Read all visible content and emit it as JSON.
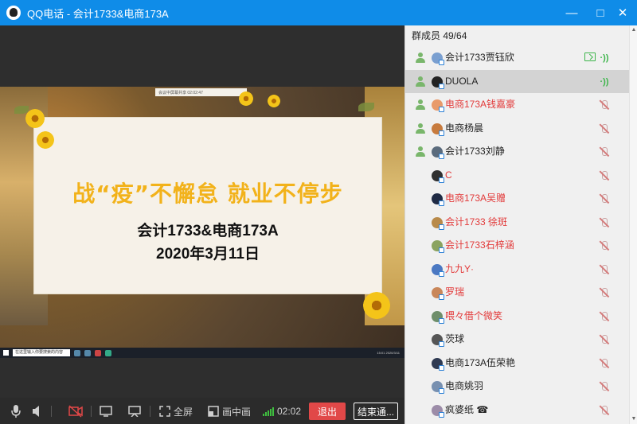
{
  "window": {
    "title": "QQ电话 - 会计1733&电商173A",
    "minimize_glyph": "—",
    "maximize_glyph": "□",
    "close_glyph": "✕"
  },
  "slide": {
    "headline": "战“疫”不懈怠 就业不停步",
    "class_line": "会计1733&电商173A",
    "date_line": "2020年3月11日",
    "top_strip_text": "会议中屏幕共享   02:02:47",
    "taskbar_search": "在这里输入你要搜索的内容",
    "taskbar_clock": "15:01 2020/3/11"
  },
  "controls": {
    "fullscreen_label": "全屏",
    "pip_label": "画中画",
    "call_timer": "02:02",
    "exit_label": "退出",
    "end_label": "结束通..."
  },
  "members": {
    "header": "群成员 49/64",
    "list": [
      {
        "name": "会计1733贾钰欣",
        "color": "black",
        "role_icon": true,
        "status": "speaking",
        "sharing": true,
        "avatar_color": "#7a9fd0"
      },
      {
        "name": "DUOLA",
        "color": "black",
        "role_icon": true,
        "status": "speaking",
        "sharing": false,
        "avatar_color": "#222222",
        "selected": true
      },
      {
        "name": "电商173A钱嘉豪",
        "color": "red",
        "role_icon": true,
        "status": "muted",
        "sharing": false,
        "avatar_color": "#e89a6a"
      },
      {
        "name": "电商杨晨",
        "color": "black",
        "role_icon": true,
        "status": "muted",
        "sharing": false,
        "avatar_color": "#c77b3e"
      },
      {
        "name": "会计1733刘静",
        "color": "black",
        "role_icon": true,
        "status": "muted",
        "sharing": false,
        "avatar_color": "#5a6b7d"
      },
      {
        "name": "C",
        "color": "red",
        "role_icon": false,
        "status": "muted",
        "sharing": false,
        "avatar_color": "#303030"
      },
      {
        "name": "电商173A吴赠",
        "color": "red",
        "role_icon": false,
        "status": "muted",
        "sharing": false,
        "avatar_color": "#1f2a44"
      },
      {
        "name": "会计1733 徐斑",
        "color": "red",
        "role_icon": false,
        "status": "muted",
        "sharing": false,
        "avatar_color": "#b88a4a"
      },
      {
        "name": "会计1733石梓涵",
        "color": "red",
        "role_icon": false,
        "status": "muted",
        "sharing": false,
        "avatar_color": "#8aa35f"
      },
      {
        "name": "九九Y·",
        "color": "red",
        "role_icon": false,
        "status": "muted",
        "sharing": false,
        "avatar_color": "#4a78c2"
      },
      {
        "name": "罗瑞",
        "color": "red",
        "role_icon": false,
        "status": "muted",
        "sharing": false,
        "avatar_color": "#c9875a"
      },
      {
        "name": "喂々借个微笑",
        "color": "red",
        "role_icon": false,
        "status": "muted",
        "sharing": false,
        "avatar_color": "#6e8e6a"
      },
      {
        "name": "茨球",
        "color": "black",
        "role_icon": false,
        "status": "muted",
        "sharing": false,
        "avatar_color": "#555555"
      },
      {
        "name": "电商173A伍荣艳",
        "color": "black",
        "role_icon": false,
        "status": "muted",
        "sharing": false,
        "avatar_color": "#2f3a52"
      },
      {
        "name": "电商姚羽",
        "color": "black",
        "role_icon": false,
        "status": "muted",
        "sharing": false,
        "avatar_color": "#7890b0"
      },
      {
        "name": "疯婆纸 ☎",
        "color": "black",
        "role_icon": false,
        "status": "muted",
        "sharing": false,
        "avatar_color": "#9c8ca8"
      }
    ]
  }
}
